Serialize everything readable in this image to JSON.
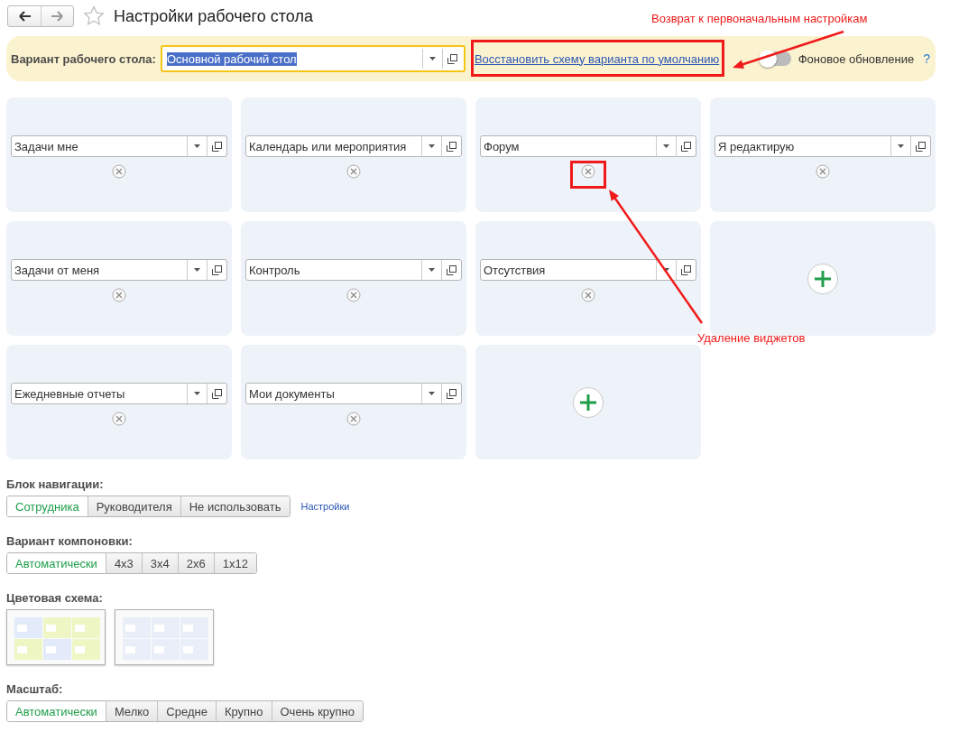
{
  "window": {
    "title": "Настройки рабочего стола",
    "favorite": false
  },
  "variant_bar": {
    "label": "Вариант рабочего стола:",
    "field": {
      "value": "Основной рабочий стол",
      "focused": true,
      "value_highlighted": true
    },
    "reset_link": "Восстановить схему варианта по умолчанию",
    "background_update": {
      "label": "Фоновое обновление",
      "on": false,
      "help": "?"
    }
  },
  "widgets": [
    {
      "kind": "widget",
      "value": "Задачи мне"
    },
    {
      "kind": "widget",
      "value": "Календарь или мероприятия"
    },
    {
      "kind": "widget",
      "value": "Форум"
    },
    {
      "kind": "widget",
      "value": "Я редактирую"
    },
    {
      "kind": "widget",
      "value": "Задачи от меня"
    },
    {
      "kind": "widget",
      "value": "Контроль"
    },
    {
      "kind": "widget",
      "value": "Отсутствия"
    },
    {
      "kind": "add"
    },
    {
      "kind": "widget",
      "value": "Ежедневные отчеты"
    },
    {
      "kind": "widget",
      "value": "Мои документы"
    },
    {
      "kind": "add"
    }
  ],
  "navigation_block": {
    "label": "Блок навигации:",
    "options": [
      {
        "label": "Сотрудника",
        "selected": true
      },
      {
        "label": "Руководителя",
        "selected": false
      },
      {
        "label": "Не использовать",
        "selected": false
      }
    ],
    "link": "Настройки"
  },
  "layout_variant": {
    "label": "Вариант компоновки:",
    "options": [
      {
        "label": "Автоматически",
        "selected": true
      },
      {
        "label": "4x3",
        "selected": false
      },
      {
        "label": "3x4",
        "selected": false
      },
      {
        "label": "2x6",
        "selected": false
      },
      {
        "label": "1x12",
        "selected": false
      }
    ]
  },
  "color_scheme": {
    "label": "Цветовая схема:",
    "options": [
      {
        "kind": "colored"
      },
      {
        "kind": "plain"
      }
    ]
  },
  "scale": {
    "label": "Масштаб:",
    "options": [
      {
        "label": "Автоматически",
        "selected": true
      },
      {
        "label": "Мелко",
        "selected": false
      },
      {
        "label": "Средне",
        "selected": false
      },
      {
        "label": "Крупно",
        "selected": false
      },
      {
        "label": "Очень крупно",
        "selected": false
      }
    ]
  },
  "annotations": [
    {
      "text": "Возврат к первоначальным настройкам"
    },
    {
      "text": "Удаление виджетов"
    }
  ]
}
